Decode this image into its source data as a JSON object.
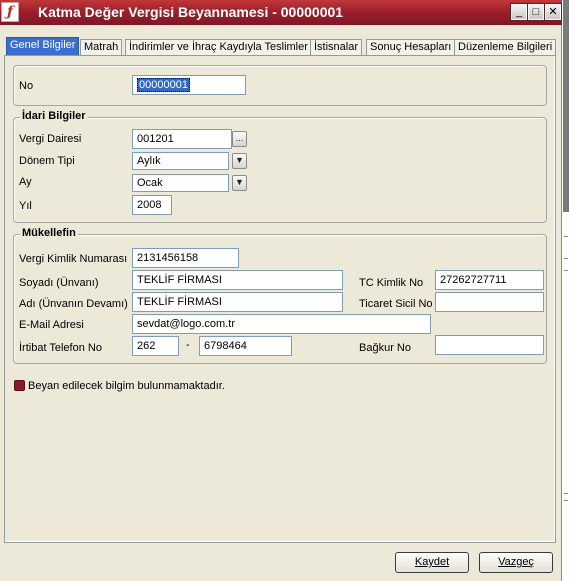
{
  "window": {
    "title": "Katma Değer Vergisi Beyannamesi - 00000001",
    "minimize_glyph": "_",
    "maximize_glyph": "□",
    "close_glyph": "✕",
    "icon_glyph": "ƒ"
  },
  "tabs": [
    {
      "label": "Genel Bilgiler",
      "active": true
    },
    {
      "label": "Matrah"
    },
    {
      "label": "İndirimler ve İhraç Kaydıyla Teslimler"
    },
    {
      "label": "İstisnalar"
    },
    {
      "label": "Sonuç Hesapları"
    },
    {
      "label": "Düzenleme Bilgileri"
    }
  ],
  "no_section": {
    "label": "No",
    "value": "00000001"
  },
  "idari": {
    "title": "İdari Bilgiler",
    "vergi_dairesi_label": "Vergi Dairesi",
    "vergi_dairesi_value": "001201",
    "lookup_button": "...",
    "donem_tipi_label": "Dönem Tipi",
    "donem_tipi_value": "Aylık",
    "ay_label": "Ay",
    "ay_value": "Ocak",
    "yil_label": "Yıl",
    "yil_value": "2008",
    "dropdown_glyph": "▼"
  },
  "mukellef": {
    "title": "Mükellefin",
    "vkn_label": "Vergi Kimlik Numarası",
    "vkn_value": "2131456158",
    "soyadi_label": "Soyadı (Ünvanı)",
    "soyadi_value": "TEKLİF FİRMASI",
    "adi_label": "Adı (Ünvanın Devamı)",
    "adi_value": "TEKLİF FİRMASI",
    "email_label": "E-Mail Adresi",
    "email_value": "sevdat@logo.com.tr",
    "telefon_label": "İrtibat Telefon No",
    "telefon_code": "262",
    "telefon_dash": "-",
    "telefon_number": "6798464",
    "tckn_label": "TC Kimlik No",
    "tckn_value": "27262727711",
    "ticaret_label": "Ticaret Sicil No",
    "ticaret_value": "",
    "bagkur_label": "Bağkur No",
    "bagkur_value": ""
  },
  "checkbox": {
    "label": "Beyan edilecek bilgim bulunmamaktadır.",
    "checked": true
  },
  "buttons": {
    "save": "Kaydet",
    "cancel": "Vazgeç"
  },
  "colors": {
    "title_bar": "#9e1f2c",
    "active_tab": "#3a6fd0",
    "panel": "#ece9d8"
  }
}
